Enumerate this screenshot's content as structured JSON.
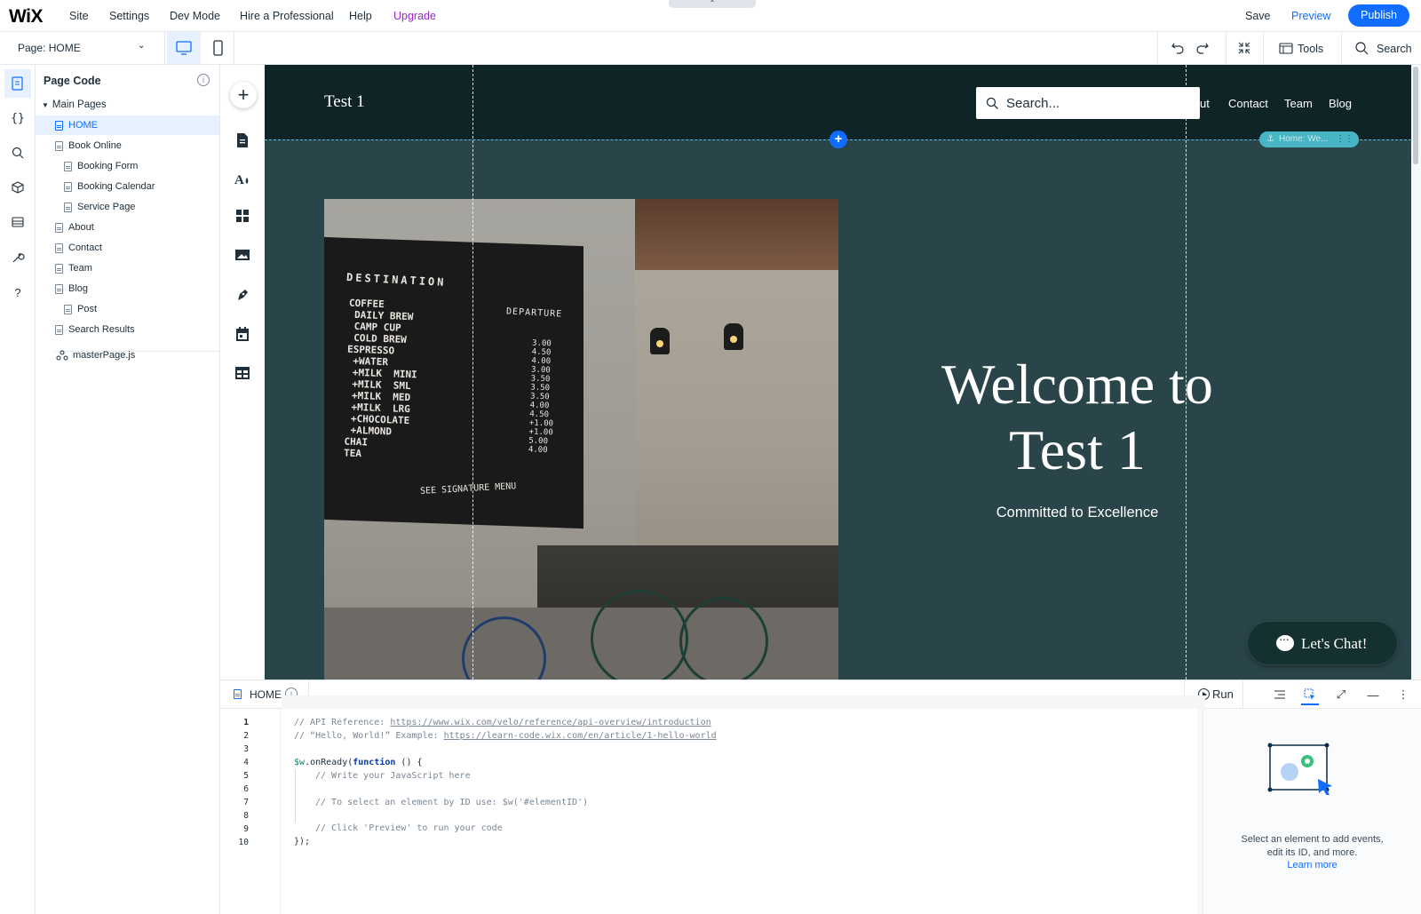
{
  "topbar": {
    "logo": "WiX",
    "menu": [
      "Site",
      "Settings",
      "Dev Mode",
      "Hire a Professional",
      "Help",
      "Upgrade"
    ],
    "collapse_icon": "chevron-up-icon",
    "save": "Save",
    "preview": "Preview",
    "publish": "Publish"
  },
  "secondbar": {
    "page_label": "Page:",
    "page_value": "HOME",
    "tools": "Tools",
    "search": "Search"
  },
  "left_rail": {
    "icons": [
      "pages-icon",
      "code-braces-icon",
      "search-icon",
      "packages-icon",
      "database-icon",
      "tools-icon",
      "help-icon"
    ]
  },
  "page_panel": {
    "title": "Page Code",
    "main_pages": "Main Pages",
    "items": [
      {
        "label": "HOME",
        "level": 1,
        "selected": true
      },
      {
        "label": "Book Online",
        "level": 1
      },
      {
        "label": "Booking Form",
        "level": 2
      },
      {
        "label": "Booking Calendar",
        "level": 2
      },
      {
        "label": "Service Page",
        "level": 2
      },
      {
        "label": "About",
        "level": 1
      },
      {
        "label": "Contact",
        "level": 1
      },
      {
        "label": "Team",
        "level": 1
      },
      {
        "label": "Blog",
        "level": 1
      },
      {
        "label": "Post",
        "level": 2
      },
      {
        "label": "Search Results",
        "level": 1
      }
    ],
    "master_page": "masterPage.js"
  },
  "site": {
    "title": "Test 1",
    "search_placeholder": "Search...",
    "nav": [
      "ut",
      "Contact",
      "Team",
      "Blog"
    ],
    "anchor_tag": "Home: We...",
    "welcome_line1": "Welcome to",
    "welcome_line2": "Test 1",
    "subtitle": "Committed to Excellence",
    "chat": "Let's Chat!",
    "board": {
      "header": "DESTINATION",
      "departure": "DEPARTURE",
      "items": "COFFEE\n DAILY BREW\n CAMP CUP\n COLD BREW\nESPRESSO\n +WATER\n +MILK  MINI\n +MILK  SML\n +MILK  MED\n +MILK  LRG\n +CHOCOLATE\n +ALMOND\nCHAI\nTEA",
      "prices": "3.00\n4.50\n4.00\n3.00\n3.50\n3.50\n3.50\n4.00\n4.50\n+1.00\n+1.00\n5.00\n4.00",
      "footer": "SEE SIGNATURE MENU"
    }
  },
  "code": {
    "tab": "HOME",
    "run": "Run",
    "lines": [
      "// API Reference: https://www.wix.com/velo/reference/api-overview/introduction",
      "// “Hello, World!” Example: https://learn-code.wix.com/en/article/1-hello-world",
      "",
      "$w.onReady(function () {",
      "    // Write your JavaScript here",
      "",
      "    // To select an element by ID use: $w('#elementID')",
      "",
      "    // Click 'Preview' to run your code",
      "});"
    ],
    "line1_prefix": "// API Reference: ",
    "line1_link": "https://www.wix.com/velo/reference/api-overview/introduction",
    "line2_prefix": "// “Hello, World!” Example: ",
    "line2_link": "https://learn-code.wix.com/en/article/1-hello-world",
    "line4_a": "$w",
    "line4_b": ".onReady(",
    "line4_kw": "function",
    "line4_c": " () {",
    "line5": "// Write your JavaScript here",
    "line7": "// To select an element by ID use: $w('#elementID')",
    "line9": "// Click 'Preview' to run your code",
    "line10": "});",
    "line_numbers": [
      "1",
      "2",
      "3",
      "4",
      "5",
      "6",
      "7",
      "8",
      "9",
      "10"
    ]
  },
  "properties": {
    "text_line1": "Select an element to add events,",
    "text_line2": "edit its ID, and more.",
    "learn_more": "Learn more"
  },
  "colors": {
    "accent": "#116dff",
    "upgrade": "#9a27d5",
    "site_header": "#0e2427",
    "site_bg": "#2a4549"
  }
}
